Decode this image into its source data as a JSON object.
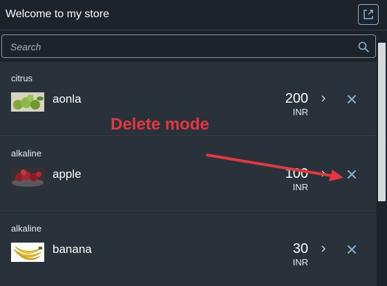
{
  "header": {
    "title": "Welcome to my store",
    "share_icon": "share-icon"
  },
  "search": {
    "placeholder": "Search",
    "value": ""
  },
  "items": [
    {
      "category": "citrus",
      "name": "aonla",
      "price": "200",
      "unit": "INR",
      "image": "aonla-thumbnail"
    },
    {
      "category": "alkaline",
      "name": "apple",
      "price": "100",
      "unit": "INR",
      "image": "apple-thumbnail"
    },
    {
      "category": "alkaline",
      "name": "banana",
      "price": "30",
      "unit": "INR",
      "image": "banana-thumbnail"
    }
  ],
  "annotation": {
    "text": "Delete mode",
    "color": "#e3383f"
  },
  "colors": {
    "background": "#1d232a",
    "row": "#29313a",
    "accent": "#8ab4d8"
  }
}
